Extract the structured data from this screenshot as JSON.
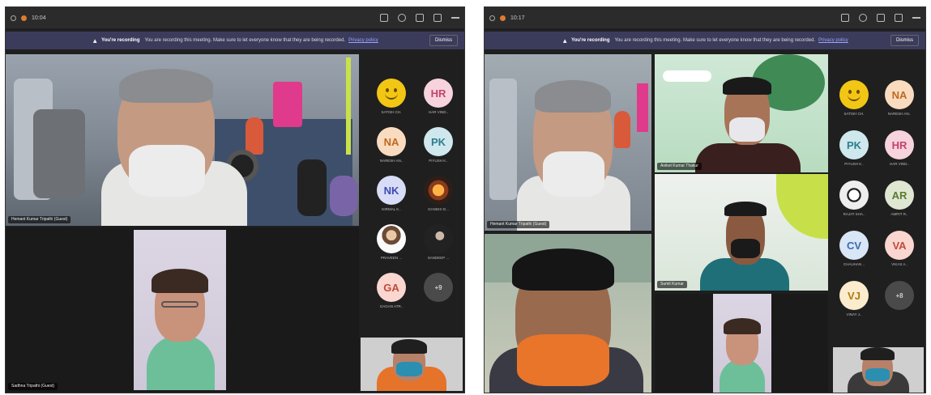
{
  "screens": [
    {
      "titlebar": {
        "time": "10:04"
      },
      "banner": {
        "strong": "You're recording",
        "text": "You are recording this meeting. Make sure to let everyone know that they are being recorded.",
        "link": "Privacy policy",
        "dismiss": "Dismiss"
      },
      "tiles": [
        {
          "name": "Hemant Kumar Tripathi (Guest)"
        },
        {
          "name": "Sadhna Tripathi (Guest)"
        }
      ],
      "roster": [
        {
          "initials": "",
          "type": "emoji",
          "name": "SATISH CH."
        },
        {
          "initials": "HR",
          "name": "HAR VIND..",
          "color": "#f6d3dd",
          "text": "#c2446a"
        },
        {
          "initials": "NA",
          "name": "NARESH AN..",
          "color": "#f9dcc0",
          "text": "#c06820"
        },
        {
          "initials": "PK",
          "name": "PIYUSH K..",
          "color": "#cfe8ee",
          "text": "#2c7d8c"
        },
        {
          "initials": "NK",
          "name": "NIRMAL K..",
          "color": "#d8dcf6",
          "text": "#3d4bb0"
        },
        {
          "initials": "",
          "type": "photo-orange",
          "name": "GANDHI D..."
        },
        {
          "initials": "",
          "type": "photo",
          "name": "PRAVEEN ..."
        },
        {
          "initials": "",
          "type": "photo-dark",
          "name": "SANDEEP ..."
        },
        {
          "initials": "GA",
          "name": "GAGAN ATR..",
          "color": "#f9d6d0",
          "text": "#c24a3a"
        },
        {
          "initials": "+9",
          "name": "",
          "color": "#4a4a4a",
          "text": "#cccccc"
        }
      ]
    },
    {
      "titlebar": {
        "time": "10:17"
      },
      "banner": {
        "strong": "You're recording",
        "text": "You are recording this meeting. Make sure to let everyone know that they are being recorded.",
        "link": "Privacy policy",
        "dismiss": "Dismiss"
      },
      "tiles": [
        {
          "name": "Hemant Kumar Tripathi (Guest)"
        },
        {
          "name": "Aniket Kumar Thakur"
        },
        {
          "name": "Sumit Kumar"
        },
        {
          "name": ""
        },
        {
          "name": ""
        }
      ],
      "roster": [
        {
          "initials": "",
          "type": "emoji",
          "name": "SATISH CH."
        },
        {
          "initials": "NA",
          "name": "NARESH AN..",
          "color": "#f9dcc0",
          "text": "#c06820"
        },
        {
          "initials": "PK",
          "name": "PIYUSH K..",
          "color": "#cfe8ee",
          "text": "#2c7d8c"
        },
        {
          "initials": "HR",
          "name": "HAR VIND..",
          "color": "#f6d3dd",
          "text": "#c2446a"
        },
        {
          "initials": "",
          "type": "photo-dog",
          "name": "RAJAT SHA.."
        },
        {
          "initials": "AR",
          "name": "AMRIT R..",
          "color": "#dfe7d3",
          "text": "#5a7a2e"
        },
        {
          "initials": "CV",
          "name": "CHAUHAN ..",
          "color": "#d8e6f6",
          "text": "#3a6cb0"
        },
        {
          "initials": "VA",
          "name": "VIKAS A..",
          "color": "#f9d6d0",
          "text": "#c24a3a"
        },
        {
          "initials": "VJ",
          "name": "VINAY J..",
          "color": "#faeccc",
          "text": "#b07a10"
        },
        {
          "initials": "+8",
          "name": "",
          "color": "#4a4a4a",
          "text": "#cccccc"
        }
      ]
    }
  ]
}
